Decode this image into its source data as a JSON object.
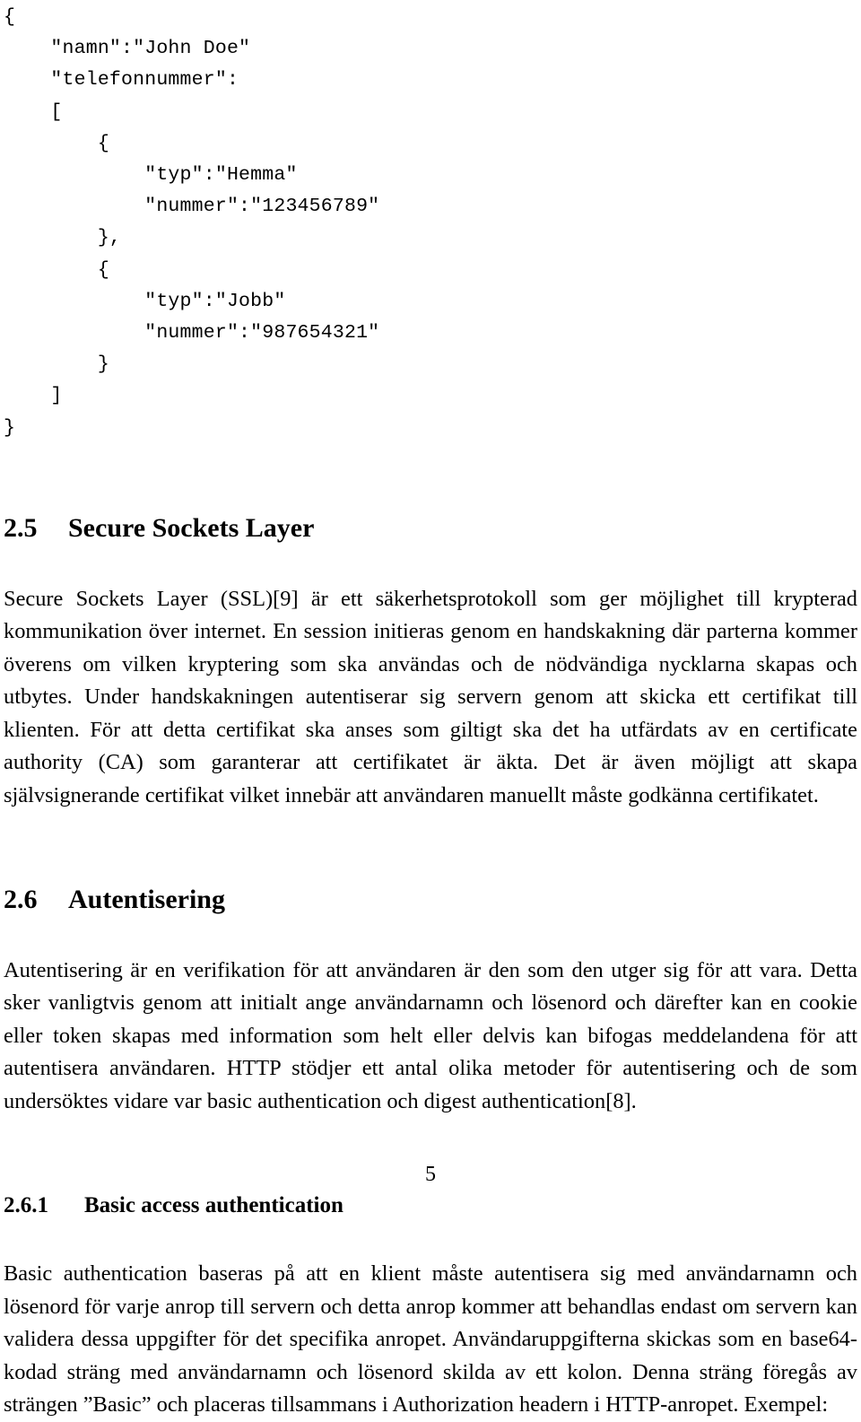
{
  "document": {
    "page_number": "5",
    "language": "sv"
  },
  "code_listing": {
    "name": "json-example-contact",
    "lines": [
      "{",
      "    \"namn\":\"John Doe\"",
      "    \"telefonnummer\":",
      "    [",
      "        {",
      "            \"typ\":\"Hemma\"",
      "            \"nummer\":\"123456789\"",
      "        },",
      "        {",
      "            \"typ\":\"Jobb\"",
      "            \"nummer\":\"987654321\"",
      "        }",
      "    ]",
      "}"
    ]
  },
  "sections": [
    {
      "number": "2.5",
      "title": "Secure Sockets Layer",
      "paragraphs": [
        "Secure Sockets Layer (SSL)[9] är ett säkerhetsprotokoll som ger möjlighet till krypterad kommunikation över internet. En session initieras genom en handskakning där parterna kommer överens om vilken kryptering som ska användas och de nödvändiga nycklarna skapas och utbytes. Under handskakningen autentiserar sig servern genom att skicka ett certifikat till klienten. För att detta certifikat ska anses som giltigt ska det ha utfärdats av en certificate authority (CA) som garanterar att certifikatet är äkta. Det är även möjligt att skapa självsignerande certifikat vilket innebär att användaren manuellt måste godkänna certifikatet."
      ]
    },
    {
      "number": "2.6",
      "title": "Autentisering",
      "paragraphs": [
        "Autentisering är en verifikation för att användaren är den som den utger sig för att vara. Detta sker vanligtvis genom att initialt ange användarnamn och lösenord och därefter kan en cookie eller token skapas med information som helt eller delvis kan bifogas meddelandena för att autentisera användaren. HTTP stödjer ett antal olika metoder för autentisering och de som undersöktes vidare var basic authentication och digest authentication[8]."
      ]
    }
  ],
  "subsections": [
    {
      "number": "2.6.1",
      "title": "Basic access authentication",
      "paragraphs": [
        "Basic authentication baseras på att en klient måste autentisera sig med användarnamn och lösenord för varje anrop till servern och detta anrop kommer att behandlas endast om servern kan validera dessa uppgifter för det specifika anropet. Användaruppgifterna skickas som en base64-kodad sträng med användarnamn och lösenord skilda av ett kolon. Denna sträng föregås av strängen ”Basic” och placeras tillsammans i Authorization headern i HTTP-anropet. Exempel:"
      ]
    }
  ]
}
